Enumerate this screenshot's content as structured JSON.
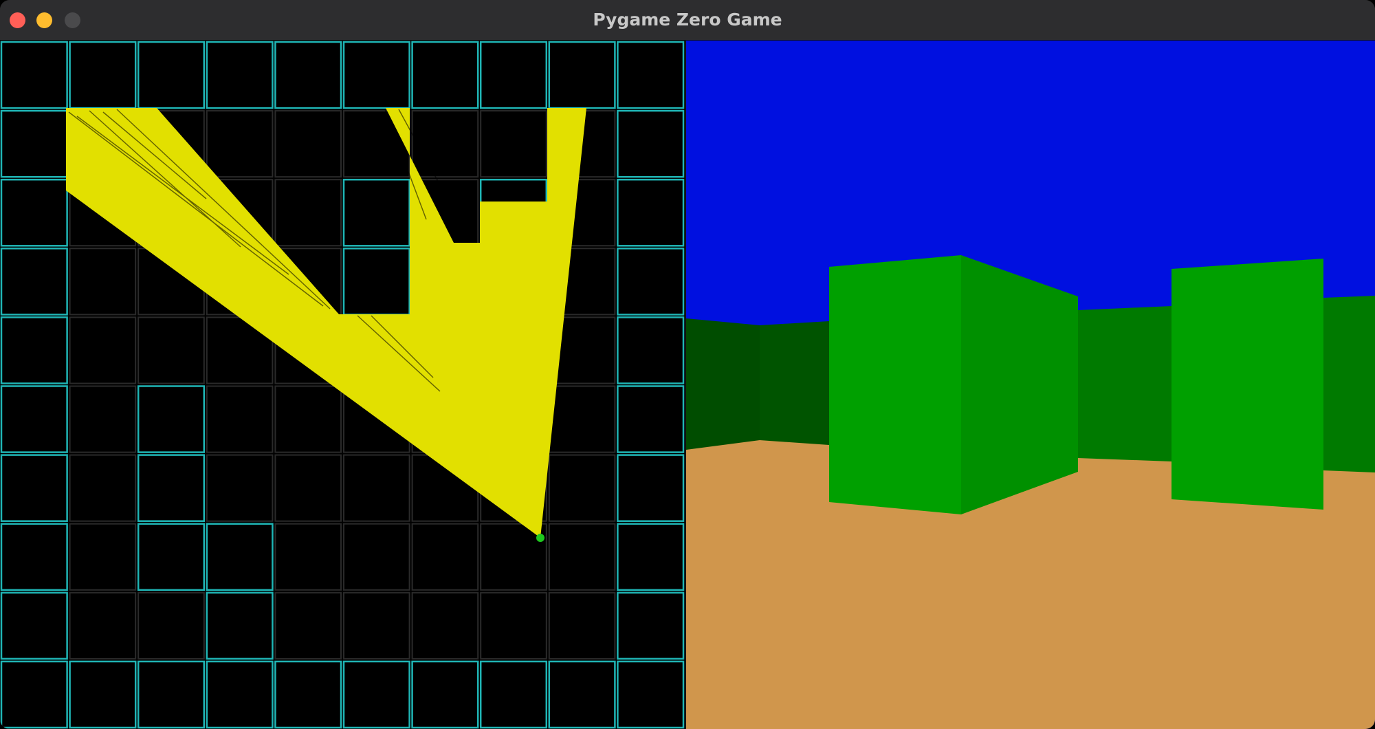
{
  "window": {
    "title": "Pygame Zero Game"
  },
  "scene": {
    "map_grid": [
      [
        1,
        1,
        1,
        1,
        1,
        1,
        1,
        1,
        1,
        1
      ],
      [
        1,
        0,
        0,
        0,
        0,
        0,
        0,
        0,
        0,
        1
      ],
      [
        1,
        0,
        0,
        0,
        0,
        1,
        0,
        1,
        0,
        1
      ],
      [
        1,
        0,
        0,
        0,
        0,
        1,
        0,
        0,
        0,
        1
      ],
      [
        1,
        0,
        0,
        0,
        0,
        0,
        0,
        0,
        0,
        1
      ],
      [
        1,
        0,
        1,
        0,
        0,
        0,
        0,
        0,
        0,
        1
      ],
      [
        1,
        0,
        1,
        0,
        0,
        0,
        0,
        0,
        0,
        1
      ],
      [
        1,
        0,
        1,
        1,
        0,
        0,
        0,
        0,
        0,
        1
      ],
      [
        1,
        0,
        0,
        1,
        0,
        0,
        0,
        0,
        0,
        1
      ],
      [
        1,
        1,
        1,
        1,
        1,
        1,
        1,
        1,
        1,
        1
      ]
    ],
    "colors": {
      "wall_outline": "#1fb5b5",
      "floor_outline": "#2a2a2a",
      "ray_fill": "#e2e000",
      "player": "#1ec81e",
      "sky": "#0010e0",
      "ground": "#d0964c",
      "wall_bright": "#00a000",
      "wall_mid": "#007a00",
      "wall_dark": "#004d00"
    }
  }
}
